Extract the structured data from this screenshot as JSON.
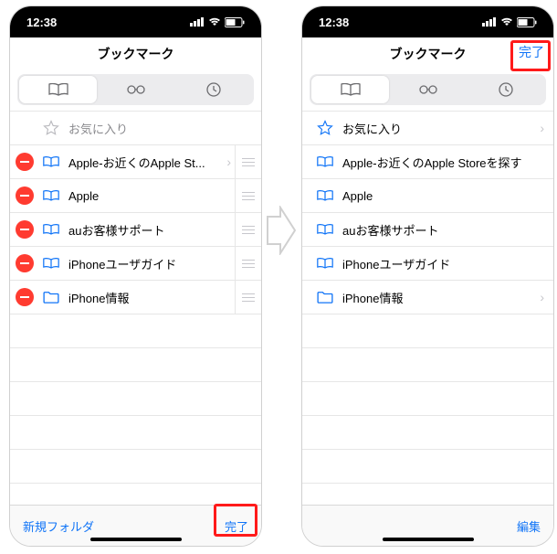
{
  "status": {
    "time": "12:38"
  },
  "navbar": {
    "title": "ブックマーク",
    "done": "完了"
  },
  "left": {
    "favorites_label": "お気に入り",
    "items": [
      {
        "label": "Apple-お近くのApple St...",
        "icon": "book"
      },
      {
        "label": "Apple",
        "icon": "book"
      },
      {
        "label": "auお客様サポート",
        "icon": "book"
      },
      {
        "label": "iPhoneユーザガイド",
        "icon": "book"
      },
      {
        "label": "iPhone情報",
        "icon": "folder"
      }
    ],
    "bottom_left": "新規フォルダ",
    "bottom_right": "完了"
  },
  "right": {
    "favorites_label": "お気に入り",
    "items": [
      {
        "label": "Apple-お近くのApple Storeを探す",
        "icon": "book"
      },
      {
        "label": "Apple",
        "icon": "book"
      },
      {
        "label": "auお客様サポート",
        "icon": "book"
      },
      {
        "label": "iPhoneユーザガイド",
        "icon": "book"
      },
      {
        "label": "iPhone情報",
        "icon": "folder"
      }
    ],
    "bottom_right": "編集"
  }
}
